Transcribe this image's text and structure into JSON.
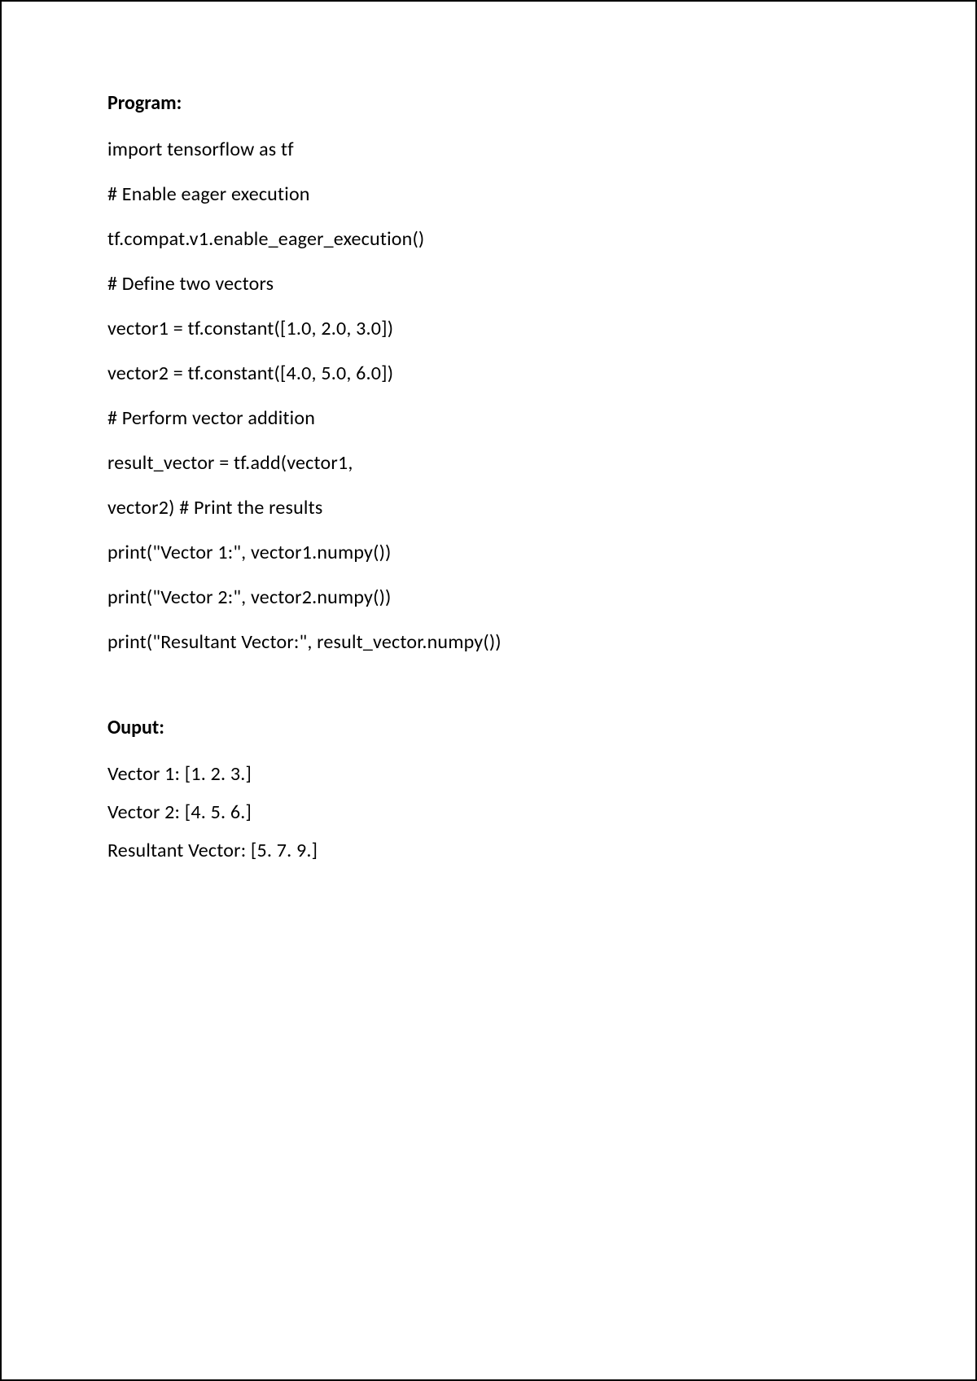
{
  "program": {
    "heading": "Program:",
    "lines": [
      "import tensorflow as tf",
      "# Enable eager execution",
      "tf.compat.v1.enable_eager_execution()",
      "# Define two vectors",
      "vector1 = tf.constant([1.0, 2.0, 3.0])",
      "vector2 = tf.constant([4.0, 5.0, 6.0])",
      "# Perform vector addition",
      "result_vector = tf.add(vector1,",
      "vector2) # Print the results",
      "print(\"Vector 1:\", vector1.numpy())",
      "print(\"Vector 2:\", vector2.numpy())",
      "print(\"Resultant Vector:\", result_vector.numpy())"
    ]
  },
  "output": {
    "heading": "Ouput:",
    "lines": [
      "Vector 1: [1. 2. 3.]",
      "Vector 2: [4. 5. 6.]",
      "Resultant Vector: [5. 7. 9.]"
    ]
  }
}
